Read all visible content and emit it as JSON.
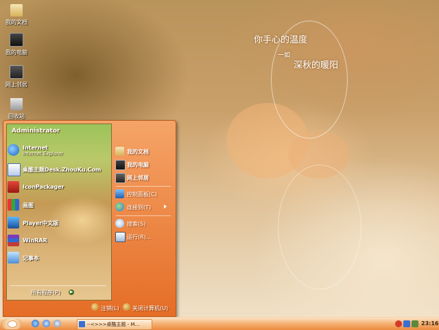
{
  "desktop": {
    "icons": [
      {
        "label": "我的文档",
        "icon": "my-documents-icon"
      },
      {
        "label": "我的电脑",
        "icon": "my-computer-icon"
      },
      {
        "label": "网上邻居",
        "icon": "network-icon"
      },
      {
        "label": "回收站",
        "icon": "recycle-bin-icon"
      }
    ],
    "poem": {
      "line1": "你手心的温度",
      "line2": "一如",
      "line3": "深秋的暖阳"
    }
  },
  "start_menu": {
    "user": "Administrator",
    "left_items": [
      {
        "title": "Internet",
        "subtitle": "Internet Explorer",
        "icon": "internet-explorer-icon"
      },
      {
        "title": "桌酷主题Desk.ZhouKu.Com",
        "subtitle": "",
        "icon": "zhouku-icon"
      },
      {
        "title": "IconPackager",
        "subtitle": "",
        "icon": "iconpackager-icon"
      },
      {
        "title": "画图",
        "subtitle": "",
        "icon": "paint-icon"
      },
      {
        "title": "Player中文版",
        "subtitle": "",
        "icon": "media-player-icon"
      },
      {
        "title": "WinRAR",
        "subtitle": "",
        "icon": "winrar-icon"
      },
      {
        "title": "记事本",
        "subtitle": "",
        "icon": "notepad-icon"
      }
    ],
    "all_programs": "所有程序(P)",
    "right_items": [
      {
        "label": "我的文档",
        "icon": "my-documents-icon",
        "bold": true
      },
      {
        "label": "我的电脑",
        "icon": "my-computer-icon",
        "bold": true
      },
      {
        "label": "网上邻居",
        "icon": "network-icon",
        "bold": true
      },
      {
        "label": "控制面板(C)",
        "icon": "control-panel-icon",
        "bold": false
      },
      {
        "label": "连接到(T)",
        "icon": "connect-icon",
        "bold": false
      },
      {
        "label": "搜索(S)",
        "icon": "search-icon",
        "bold": false
      },
      {
        "label": "运行(R)...",
        "icon": "run-icon",
        "bold": false
      }
    ],
    "logoff": "注销(L)",
    "shutdown": "关闭计算机(U)"
  },
  "taskbar": {
    "task_label": "--<>>>桌酷主题 - M...",
    "clock": "23:16"
  },
  "colors": {
    "menu_accent": "#e56d26",
    "taskbar": "#ec8a3e"
  }
}
